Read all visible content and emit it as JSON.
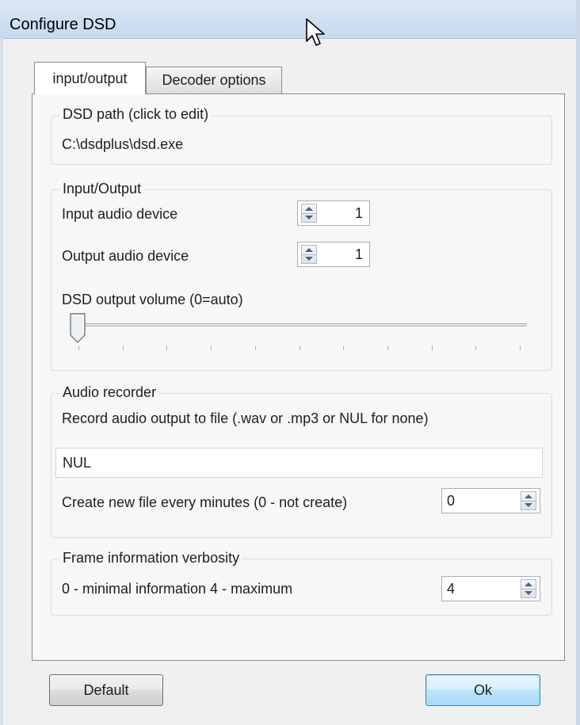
{
  "window": {
    "title": "Configure DSD"
  },
  "tabs": [
    {
      "label": "input/output",
      "active": true
    },
    {
      "label": "Decoder options",
      "active": false
    }
  ],
  "dsd_path": {
    "legend": "DSD path (click to edit)",
    "value": "C:\\dsdplus\\dsd.exe"
  },
  "io": {
    "legend": "Input/Output",
    "input_label": "Input audio device",
    "input_value": "1",
    "output_label": "Output audio device",
    "output_value": "1",
    "volume_label": "DSD output volume (0=auto)",
    "volume_level": 0
  },
  "recorder": {
    "legend": "Audio recorder",
    "description": "Record audio output to file (.wav or .mp3 or NUL for none)",
    "file_value": "NUL",
    "interval_label": "Create new  file every minutes (0 - not create)",
    "interval_value": "0"
  },
  "verbosity": {
    "legend": "Frame information verbosity",
    "label": "0 - minimal information 4 - maximum",
    "value": "4"
  },
  "buttons": {
    "default_label": "Default",
    "ok_label": "Ok"
  },
  "icons": {
    "cursor": "mouse-pointer-icon",
    "spin_up": "arrow-up-icon",
    "spin_down": "arrow-down-icon"
  },
  "colors": {
    "titlebar": "#c6d9ef",
    "ok_button": "#bee6fd",
    "group_border": "#d5dfe5"
  }
}
